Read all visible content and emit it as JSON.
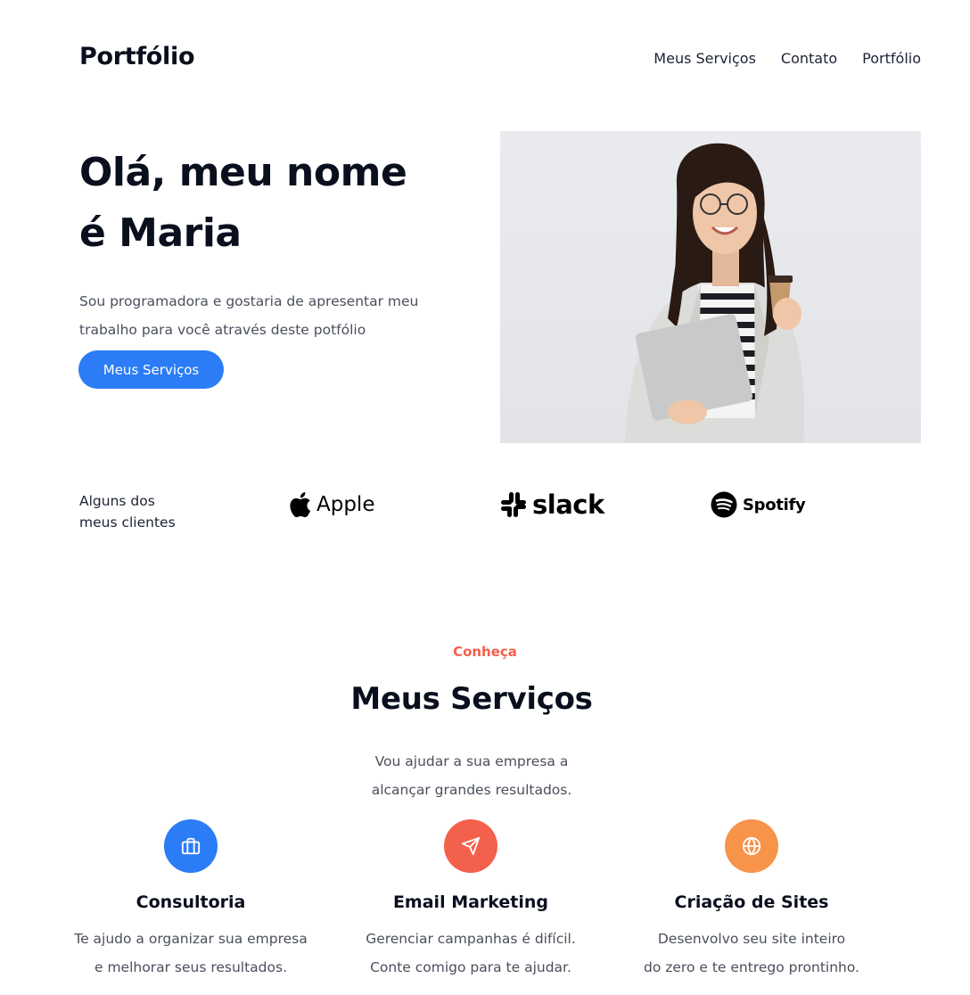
{
  "header": {
    "logo": "Portfólio",
    "nav": [
      "Meus Serviços",
      "Contato",
      "Portfólio"
    ]
  },
  "hero": {
    "title_line1": "Olá, meu nome",
    "title_line2": "é Maria",
    "description": "Sou programadora e gostaria de apresentar meu trabalho para você através deste potfólio",
    "button_label": "Meus Serviços",
    "photo_icon": "person-photo"
  },
  "clients": {
    "label_line1": "Alguns dos",
    "label_line2": "meus clientes",
    "logos": [
      {
        "name": "Apple",
        "icon": "apple-icon"
      },
      {
        "name": "slack",
        "icon": "slack-icon"
      },
      {
        "name": "Spotify",
        "icon": "spotify-icon"
      }
    ]
  },
  "services": {
    "kicker": "Conheça",
    "title": "Meus Serviços",
    "desc_line1": "Vou ajudar a sua empresa a",
    "desc_line2": "alcançar grandes resultados.",
    "items": [
      {
        "title": "Consultoria",
        "desc_line1": "Te ajudo a organizar sua empresa",
        "desc_line2": "e melhorar seus resultados.",
        "icon": "briefcase-icon",
        "color": "#2b7cf6"
      },
      {
        "title": "Email Marketing",
        "desc_line1": "Gerenciar campanhas é difícil.",
        "desc_line2": "Conte comigo para te ajudar.",
        "icon": "send-icon",
        "color": "#f3604c"
      },
      {
        "title": "Criação de Sites",
        "desc_line1": "Desenvolvo seu site inteiro",
        "desc_line2": "do zero e te entrego prontinho.",
        "icon": "globe-icon",
        "color": "#f7944a"
      }
    ]
  },
  "colors": {
    "primary": "#2b7cf6",
    "accent": "#f3604c",
    "orange": "#f7944a",
    "text": "#0a0f1e"
  }
}
